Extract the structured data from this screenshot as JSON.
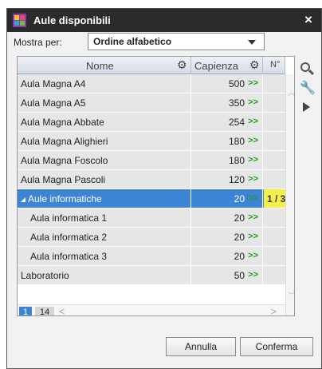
{
  "window": {
    "title": "Aule disponibili",
    "close_glyph": "×"
  },
  "filter": {
    "label": "Mostra per:",
    "selected": "Ordine alfabetico"
  },
  "columns": {
    "name": "Nome",
    "capacity": "Capienza",
    "number": "N°"
  },
  "rows": [
    {
      "name": "Aula Magna  A4",
      "capacity": "500",
      "arrow": ">>"
    },
    {
      "name": "Aula Magna  A5",
      "capacity": "350",
      "arrow": ">>"
    },
    {
      "name": "Aula Magna Abbate",
      "capacity": "254",
      "arrow": ">>"
    },
    {
      "name": "Aula Magna Alighieri",
      "capacity": "180",
      "arrow": ">>"
    },
    {
      "name": "Aula Magna Foscolo",
      "capacity": "180",
      "arrow": ">>"
    },
    {
      "name": "Aula Magna Pascoli",
      "capacity": "120",
      "arrow": ">>"
    },
    {
      "name": "Aule informatiche",
      "capacity": "20",
      "arrow": ">>",
      "number": "1 / 3",
      "selected": true
    },
    {
      "name": "Aula informatica 1",
      "capacity": "20",
      "arrow": ">>"
    },
    {
      "name": "Aula informatica 2",
      "capacity": "20",
      "arrow": ">>"
    },
    {
      "name": "Aula informatica 3",
      "capacity": "20",
      "arrow": ">>"
    },
    {
      "name": "Laboratorio",
      "capacity": "50",
      "arrow": ">>"
    }
  ],
  "pager": {
    "current": "1",
    "total": "14",
    "prev": "<",
    "next": ">"
  },
  "buttons": {
    "cancel": "Annulla",
    "confirm": "Conferma"
  },
  "icons": {
    "app": "app-logo-icon",
    "close": "close-icon",
    "settings": "gear-icon",
    "search": "search-icon",
    "tools": "wrench-icon",
    "play": "play-icon",
    "expand": "collapse-triangle-icon",
    "dropdown": "chevron-down-icon"
  },
  "colors": {
    "titlebar": "#2b2b2b",
    "selection": "#3d84d4",
    "highlight": "#f4f04a",
    "arrow": "#1ea01e",
    "row": "#e6e6e6"
  }
}
